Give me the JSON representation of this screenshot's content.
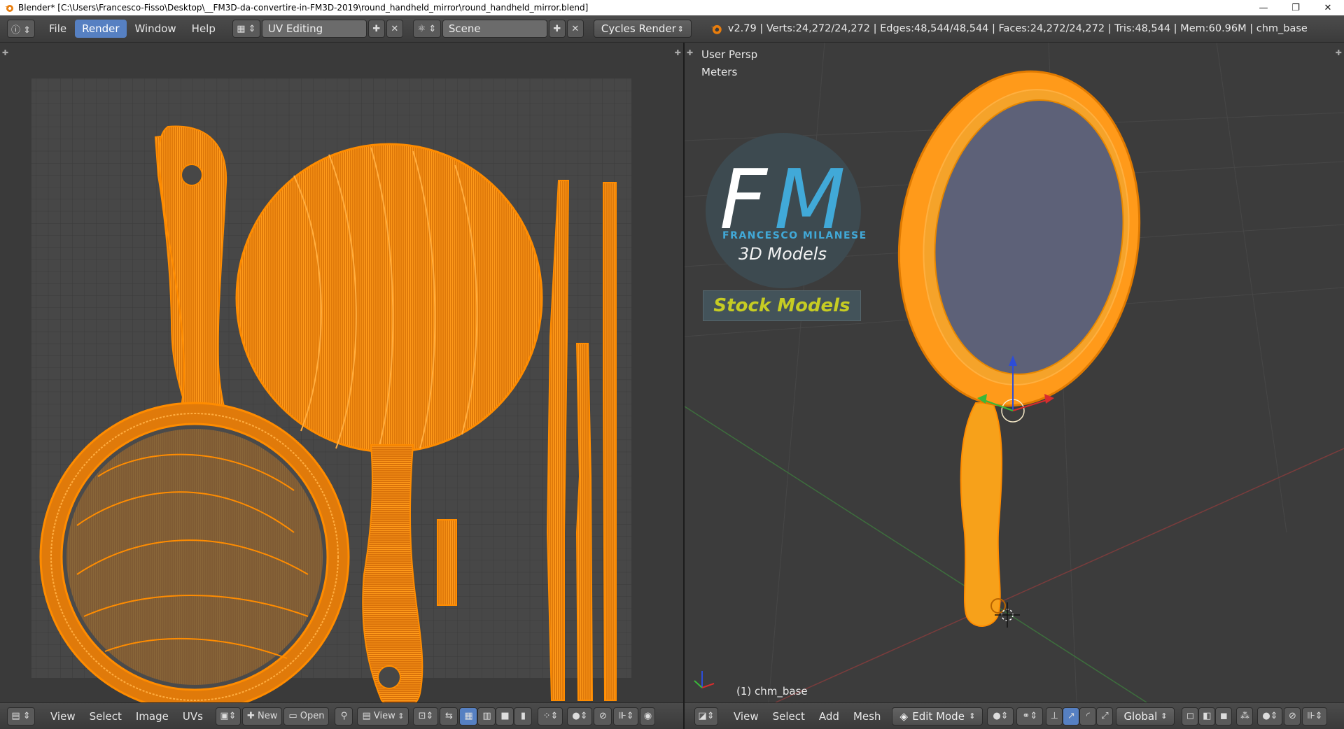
{
  "window": {
    "title": "Blender* [C:\\Users\\Francesco-Fisso\\Desktop\\__FM3D-da-convertire-in-FM3D-2019\\round_handheld_mirror\\round_handheld_mirror.blend]",
    "minimize": "—",
    "restore": "❐",
    "close": "✕"
  },
  "infobar": {
    "editor_icon": "info-icon",
    "menus": [
      "File",
      "Render",
      "Window",
      "Help"
    ],
    "active_menu": "Render",
    "screen_layout": "UV Editing",
    "scene": "Scene",
    "render_engine": "Cycles Render",
    "stats": "v2.79 | Verts:24,272/24,272 | Edges:48,544/48,544 | Faces:24,272/24,272 | Tris:48,544 | Mem:60.96M | chm_base"
  },
  "uv_editor": {
    "footer": {
      "menus": [
        "View",
        "Select",
        "Image",
        "UVs"
      ],
      "new_label": "New",
      "open_label": "Open",
      "view_label": "View"
    }
  },
  "viewport": {
    "view_name": "User Persp",
    "units": "Meters",
    "object_label": "(1) chm_base",
    "logo": {
      "letters_f": "F",
      "letters_m": "M",
      "author": "FRANCESCO MILANESE",
      "subtitle": "3D Models",
      "badge": "Stock Models"
    },
    "footer": {
      "menus": [
        "View",
        "Select",
        "Add",
        "Mesh"
      ],
      "mode": "Edit Mode",
      "orientation": "Global"
    }
  },
  "colors": {
    "mesh_orange": "#ff8c00",
    "ui_dark": "#3d3d3d",
    "header_active": "#5680c2",
    "mirror_glass": "#5d6178"
  }
}
